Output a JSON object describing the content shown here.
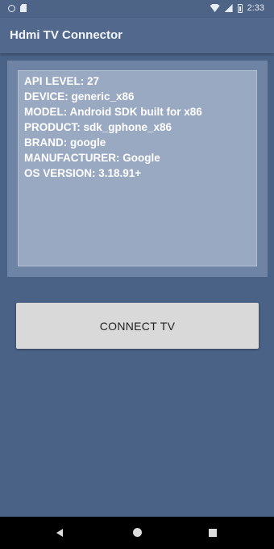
{
  "status_bar": {
    "time": "2:33",
    "icons": [
      "circle-icon",
      "sd-card-icon",
      "wifi-icon",
      "signal-icon",
      "battery-icon"
    ]
  },
  "app_bar": {
    "title": "Hdmi TV Connector"
  },
  "device_info": {
    "lines": [
      "API LEVEL: 27",
      "DEVICE: generic_x86",
      "MODEL: Android SDK built for x86",
      "PRODUCT: sdk_gphone_x86",
      "BRAND: google",
      "MANUFACTURER: Google",
      "OS VERSION: 3.18.91+"
    ]
  },
  "connect_button": {
    "label": "CONNECT TV"
  },
  "nav_bar": {
    "icons": [
      "back-icon",
      "home-icon",
      "recents-icon"
    ]
  },
  "colors": {
    "background": "#4a6286",
    "app_bar": "#52698d",
    "info_panel_outer": "#6f84a4",
    "info_panel_inner": "#9aa9c2",
    "button": "#d9d9d9"
  }
}
